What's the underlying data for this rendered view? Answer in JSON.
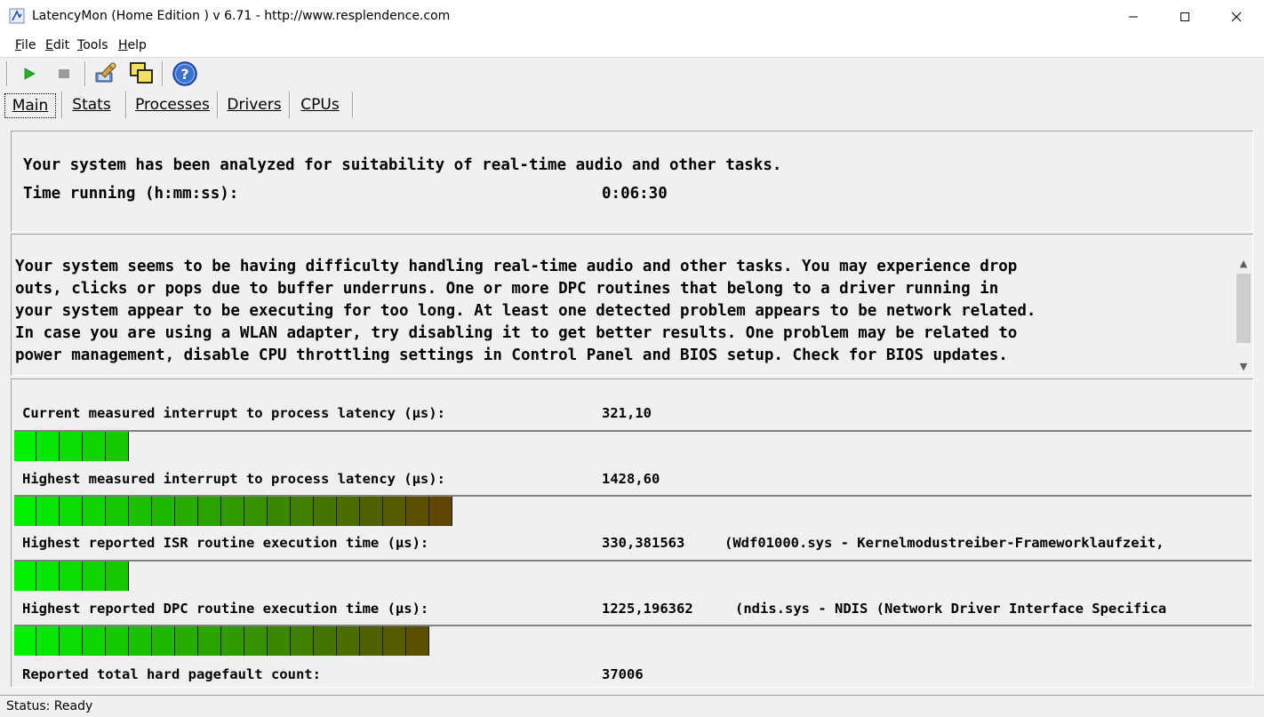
{
  "window": {
    "title": "LatencyMon (Home Edition ) v 6.71 - http://www.resplendence.com"
  },
  "menu": [
    {
      "label": "File",
      "accel": "F",
      "rest": "ile"
    },
    {
      "label": "Edit",
      "accel": "E",
      "rest": "dit"
    },
    {
      "label": "Tools",
      "accel": "T",
      "rest": "ools"
    },
    {
      "label": "Help",
      "accel": "H",
      "rest": "elp"
    }
  ],
  "toolbar": {
    "icons": [
      "play-icon",
      "stop-icon",
      "wrench-icon",
      "windows-icon",
      "help-icon"
    ]
  },
  "tabs": [
    "Main",
    "Stats",
    "Processes",
    "Drivers",
    "CPUs"
  ],
  "summary": {
    "line1": "Your system has been analyzed for suitability of real-time audio and other tasks.",
    "time_label": "Time running (h:mm:ss):",
    "time_value": "0:06:30"
  },
  "message": "Your system seems to be having difficulty handling real-time audio and other tasks. You may experience drop\nouts, clicks or pops due to buffer underruns. One or more DPC routines that belong to a driver running in\nyour system appear to be executing for too long. At least one detected problem appears to be network related.\nIn case you are using a WLAN adapter, try disabling it to get better results. One problem may be related to\npower management, disable CPU throttling settings in Control Panel and BIOS setup. Check for BIOS updates.",
  "metrics": [
    {
      "label": "Current measured interrupt to process latency (µs):",
      "value": "321,10",
      "extra": "",
      "segments": 5
    },
    {
      "label": "Highest measured interrupt to process latency (µs):",
      "value": "1428,60",
      "extra": "",
      "segments": 19
    },
    {
      "label": "Highest reported ISR routine execution time (µs):",
      "value": "330,381563",
      "extra": "(Wdf01000.sys - Kernelmodustreiber-Frameworklaufzeit,",
      "segments": 5
    },
    {
      "label": "Highest reported DPC routine execution time (µs):",
      "value": "1225,196362",
      "extra": "(ndis.sys - NDIS (Network Driver Interface Specifica",
      "segments": 18
    },
    {
      "label": "Reported total hard pagefault count:",
      "value": "37006",
      "extra": ""
    }
  ],
  "status": "Status: Ready"
}
